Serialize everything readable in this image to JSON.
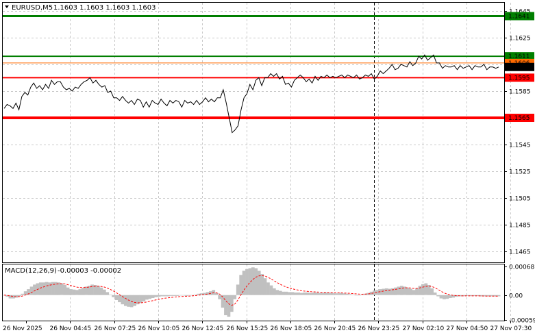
{
  "header": {
    "symbol": "EURUSD,M5",
    "ohlc": "1.1603 1.1603 1.1603 1.1603",
    "macd_label": "MACD(12,26,9)",
    "macd_values": "-0.00003 -0.00002"
  },
  "colors": {
    "price_line": "#000000",
    "resistance": "#007f00",
    "support": "#ff0000",
    "current_bg": "#000000",
    "orange_level": "#ff6a00",
    "histogram": "#c0c0c0",
    "signal": "#ff0000",
    "grid": "#c8c8c8"
  },
  "chart_data": [
    {
      "type": "line",
      "title": "EURUSD,M5",
      "ylim": [
        1.1457,
        1.1651
      ],
      "y_ticks": [
        "1.1645",
        "1.1625",
        "1.1605",
        "1.1585",
        "1.1565",
        "1.1545",
        "1.1525",
        "1.1505",
        "1.1485",
        "1.1465"
      ],
      "x_ticks": [
        "26 Nov 2025",
        "26 Nov 04:45",
        "26 Nov 07:25",
        "26 Nov 10:05",
        "26 Nov 12:45",
        "26 Nov 15:25",
        "26 Nov 18:05",
        "26 Nov 20:45",
        "26 Nov 23:25",
        "27 Nov 02:10",
        "27 Nov 04:50",
        "27 Nov 07:30"
      ],
      "levels": [
        {
          "value": 1.1641,
          "label": "1.1641",
          "kind": "resistance",
          "width": 3
        },
        {
          "value": 1.1611,
          "label": "1.1611",
          "kind": "resistance",
          "width": 2
        },
        {
          "value": 1.1606,
          "label": "1.1606",
          "kind": "orange",
          "width": 1
        },
        {
          "value": 1.1595,
          "label": "1.1595",
          "kind": "support",
          "width": 2
        },
        {
          "value": 1.1565,
          "label": "1.1565",
          "kind": "support",
          "width": 4
        }
      ],
      "current": {
        "value": 1.1603,
        "label": "1.1603"
      },
      "session_separator_x": "26 Nov 23:25",
      "series": [
        {
          "values": [
            1.1572,
            1.1575,
            1.1574,
            1.1572,
            1.1576,
            1.1571,
            1.1581,
            1.1584,
            1.1582,
            1.1588,
            1.1591,
            1.1587,
            1.1589,
            1.1586,
            1.159,
            1.1587,
            1.1593,
            1.159,
            1.1592,
            1.1592,
            1.1588,
            1.1586,
            1.1587,
            1.1585,
            1.1588,
            1.1587,
            1.159,
            1.1592,
            1.1593,
            1.1595,
            1.1591,
            1.1593,
            1.159,
            1.1588,
            1.1589,
            1.1584,
            1.1585,
            1.158,
            1.158,
            1.1578,
            1.1581,
            1.1578,
            1.1576,
            1.1578,
            1.1575,
            1.1579,
            1.1578,
            1.1573,
            1.1577,
            1.1573,
            1.1578,
            1.1576,
            1.1575,
            1.1579,
            1.1576,
            1.1574,
            1.1578,
            1.1576,
            1.1578,
            1.1577,
            1.1573,
            1.1578,
            1.1576,
            1.1577,
            1.1575,
            1.1578,
            1.1575,
            1.1577,
            1.158,
            1.1577,
            1.1579,
            1.1577,
            1.158,
            1.158,
            1.1586,
            1.1576,
            1.1565,
            1.1554,
            1.1556,
            1.1559,
            1.1571,
            1.158,
            1.1583,
            1.159,
            1.1586,
            1.1593,
            1.1595,
            1.1589,
            1.1595,
            1.1595,
            1.1598,
            1.1596,
            1.1598,
            1.1594,
            1.1596,
            1.159,
            1.1591,
            1.1588,
            1.1593,
            1.1595,
            1.1597,
            1.1595,
            1.1592,
            1.1594,
            1.1591,
            1.1596,
            1.1593,
            1.1596,
            1.1595,
            1.1597,
            1.1595,
            1.1596,
            1.1595,
            1.1596,
            1.1597,
            1.1595,
            1.1597,
            1.1596,
            1.1595,
            1.1597,
            1.1594,
            1.1595,
            1.1597,
            1.1596,
            1.1598,
            1.1594,
            1.1596,
            1.16,
            1.1598,
            1.16,
            1.1602,
            1.1605,
            1.1601,
            1.1602,
            1.1605,
            1.1604,
            1.1603,
            1.1607,
            1.1604,
            1.1606,
            1.1611,
            1.1609,
            1.1612,
            1.1608,
            1.161,
            1.1612,
            1.1606,
            1.1606,
            1.1602,
            1.1604,
            1.1603,
            1.1603,
            1.1604,
            1.1601,
            1.1604,
            1.1602,
            1.1603,
            1.1604,
            1.1601,
            1.1604,
            1.1603,
            1.1603,
            1.1605,
            1.1601,
            1.1603,
            1.1603,
            1.1602,
            1.1603
          ]
        }
      ]
    },
    {
      "type": "bar",
      "title": "MACD(12,26,9)",
      "ylim": [
        -0.00061,
        0.00073
      ],
      "y_ticks": [
        "0.00068",
        "0.00",
        "-0.00059"
      ],
      "series": [
        {
          "name": "MACD",
          "values": [
            0.0,
            -4e-05,
            -8e-05,
            -8e-05,
            -6e-05,
            -3e-05,
            3e-05,
            9e-05,
            0.00014,
            0.0002,
            0.00025,
            0.00028,
            0.0003,
            0.0003,
            0.00031,
            0.0003,
            0.00031,
            0.00031,
            0.0003,
            0.00028,
            0.00024,
            0.00018,
            0.00014,
            0.00013,
            0.00012,
            0.00014,
            0.00017,
            0.0002,
            0.00022,
            0.00025,
            0.00024,
            0.00022,
            0.00018,
            0.00013,
            7e-05,
            1e-05,
            -5e-05,
            -0.00012,
            -0.00017,
            -0.00022,
            -0.00026,
            -0.00028,
            -0.00029,
            -0.00026,
            -0.00022,
            -0.00019,
            -0.00015,
            -0.00011,
            -9e-05,
            -7e-05,
            -5e-05,
            -4e-05,
            -3e-05,
            -3e-05,
            -3e-05,
            -2e-05,
            -2e-05,
            -2e-05,
            -1e-05,
            -1e-05,
            -2e-05,
            -1e-05,
            0.0,
            1e-05,
            3e-05,
            4e-05,
            5e-05,
            7e-05,
            9e-05,
            0.00012,
            5e-05,
            -0.0001,
            -0.0003,
            -0.00048,
            -0.00052,
            -0.0004,
            -0.0001,
            0.00025,
            0.00048,
            0.00058,
            0.00062,
            0.00064,
            0.00066,
            0.00064,
            0.00058,
            0.0005,
            0.0004,
            0.0003,
            0.00023,
            0.00016,
            0.00012,
            0.0001,
            8e-05,
            8e-05,
            7e-05,
            7e-05,
            6e-05,
            6e-05,
            5e-05,
            6e-05,
            6e-05,
            5e-05,
            6e-05,
            6e-05,
            5e-05,
            5e-05,
            6e-05,
            5e-05,
            5e-05,
            4e-05,
            4e-05,
            5e-05,
            4e-05,
            3e-05,
            2e-05,
            1e-05,
            0.0,
            0.0,
            1e-05,
            3e-05,
            5e-05,
            8e-05,
            0.00011,
            0.00012,
            0.00014,
            0.00015,
            0.00016,
            0.00015,
            0.00016,
            0.00018,
            0.0002,
            0.00022,
            0.0002,
            0.00018,
            0.00015,
            0.00012,
            0.00016,
            0.00022,
            0.00026,
            0.00028,
            0.00024,
            0.00016,
            6e-05,
            -3e-05,
            -8e-05,
            -0.0001,
            -9e-05,
            -7e-05,
            -6e-05,
            -4e-05,
            -3e-05,
            -3e-05,
            -2e-05,
            -2e-05,
            -2e-05,
            -2e-05,
            -2e-05,
            -3e-05,
            -3e-05,
            -3e-05,
            -3e-05,
            -3e-05,
            -3e-05,
            -3e-05
          ]
        }
      ]
    }
  ]
}
